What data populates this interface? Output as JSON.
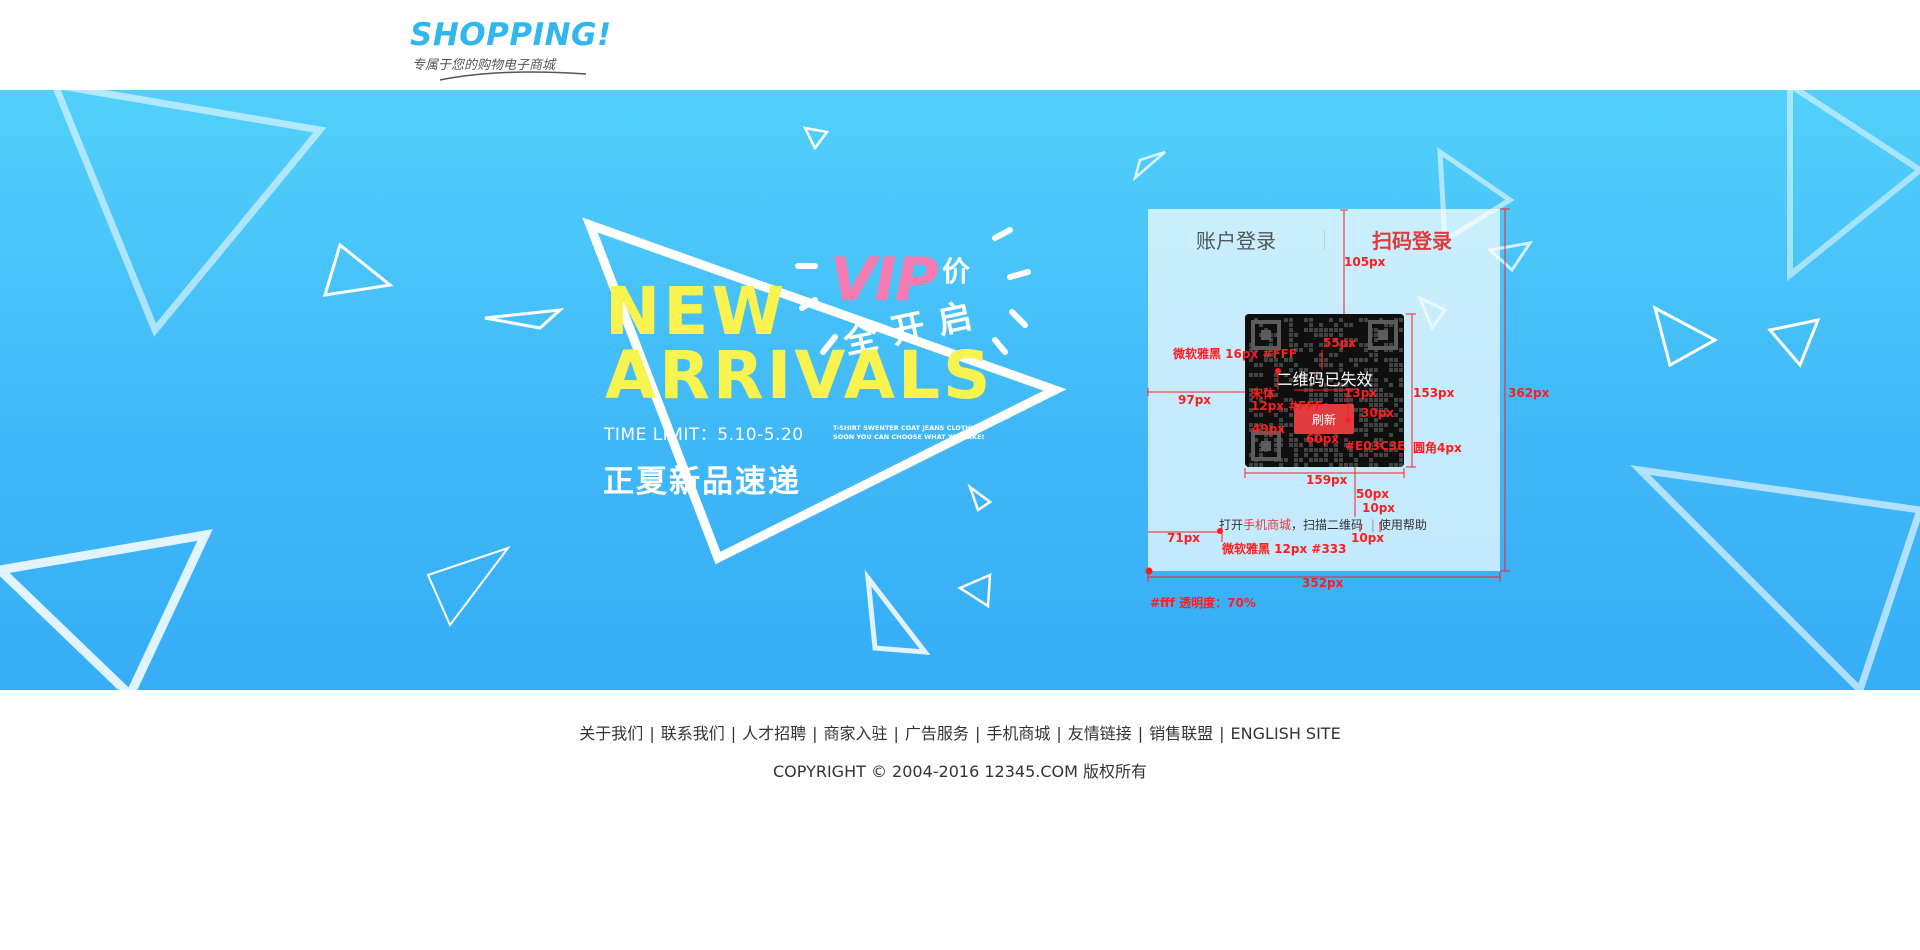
{
  "header": {
    "logo_title": "SHOPPING!",
    "logo_subtitle": "专属于您的购物电子商城"
  },
  "banner": {
    "vip": "VIP",
    "vip_price": "价",
    "vip_open": "全开启",
    "headline_line1": "NEW",
    "headline_line2": "ARRIVALS",
    "time_limit": "TIME LIMIT：5.10-5.20",
    "small_en_line1": "T-SHIRT SWENTER COAT JEANS CLOTHING",
    "small_en_line2": "SOON YOU CAN CHOOSE WHAT YOU LIKE!",
    "slogan": "正夏新品速递"
  },
  "login": {
    "tab_account": "账户登录",
    "tab_qr": "扫码登录",
    "qr_expired": "二维码已失效",
    "refresh_button": "刷新",
    "scan_tip_prefix": "打开",
    "scan_tip_link": "手机商城",
    "scan_tip_middle": "，扫描二维码",
    "scan_tip_sep": "|",
    "scan_tip_help": "使用帮助"
  },
  "annotations": {
    "a_105": "105px",
    "a_55": "55px",
    "a_font1": "微软雅黑 16px #FFF",
    "a_97": "97px",
    "a_songti": "宋体",
    "a_font2": "12px #FFF",
    "a_13": "13px",
    "a_153": "153px",
    "a_362": "362px",
    "a_30": "30px",
    "a_49": "49px",
    "a_60": "60px",
    "a_color": "#E03C3E",
    "a_radius": "圆角4px",
    "a_159": "159px",
    "a_50": "50px",
    "a_10a": "10px",
    "a_71": "71px",
    "a_10b": "10px",
    "a_font3": "微软雅黑 12px #333",
    "a_352": "352px",
    "a_bg": "#fff 透明度：70%"
  },
  "footer": {
    "links": [
      "关于我们",
      "联系我们",
      "人才招聘",
      "商家入驻",
      "广告服务",
      "手机商城",
      "友情链接",
      "销售联盟",
      "ENGLISH SITE"
    ],
    "separator": "|",
    "copyright": "COPYRIGHT © 2004-2016  12345.COM 版权所有"
  },
  "colors": {
    "logo": "#31b6ee",
    "banner_top": "#52d0fb",
    "banner_bottom": "#36aef7",
    "headline": "#f9f34f",
    "vip": "#f47bb0",
    "accent_red": "#e03c3e",
    "annotation_red": "#ff1d1d"
  }
}
